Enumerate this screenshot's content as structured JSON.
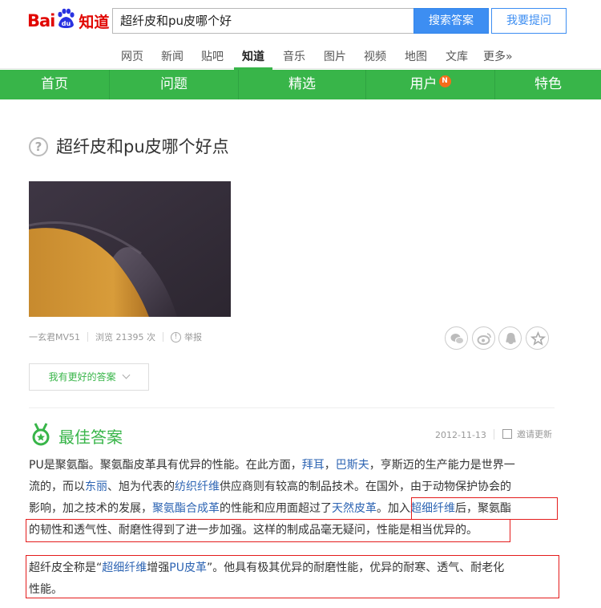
{
  "header": {
    "logo": {
      "bai": "Bai",
      "du": "du",
      "zhidao": "知道"
    },
    "search_value": "超纤皮和pu皮哪个好",
    "search_button": "搜索答案",
    "ask_button": "我要提问"
  },
  "channels": [
    "网页",
    "新闻",
    "贴吧",
    "知道",
    "音乐",
    "图片",
    "视频",
    "地图",
    "文库",
    "更多»"
  ],
  "active_channel": "知道",
  "green_nav": {
    "items": [
      "首页",
      "问题",
      "精选",
      "用户",
      "特色"
    ],
    "user_badge": "N"
  },
  "question": {
    "icon_glyph": "?",
    "title": "超纤皮和pu皮哪个好点",
    "author": "一玄君MV51",
    "views": "浏览 21395 次",
    "report_icon_glyph": "!",
    "report": "举报",
    "better_answer_button": "我有更好的答案",
    "share_icons": [
      "wechat-icon",
      "weibo-icon",
      "qq-icon",
      "favorite-star-icon"
    ]
  },
  "best_answer": {
    "title": "最佳答案",
    "date": "2012-11-13",
    "invite": "邀请更新",
    "lines": [
      [
        "PU是聚氨酯。聚氨酯皮革具有优异的性能。在此方面，",
        {
          "link": "拜耳"
        },
        "，",
        {
          "link": "巴斯夫"
        },
        "，亨斯迈的生产能力是世界一"
      ],
      [
        "流的，而以",
        {
          "link": "东丽"
        },
        "、旭为代表的",
        {
          "link": "纺织纤维"
        },
        "供应商则有较高的制品技术。在国外，由于动物保护协会的"
      ],
      [
        "影响，加之技术的发展，",
        {
          "link": "聚氨酯合成革"
        },
        "的性能和应用面超过了",
        {
          "link": "天然皮革"
        },
        "。加入",
        {
          "link": "超细纤维"
        },
        "后，聚氨酯"
      ],
      [
        "的韧性和透气性、耐磨性得到了进一步加强。这样的制成品毫无疑问，性能是相当优异的。"
      ],
      [
        "超纤皮全称是“",
        {
          "link": "超细纤维"
        },
        "增强",
        {
          "link": "PU皮革"
        },
        "”。他具有极其优异的耐磨性能，优异的耐寒、透气、耐老化"
      ],
      [
        "性能。"
      ]
    ]
  },
  "colors": {
    "brand_red": "#e10601",
    "baidu_blue": "#2932e1",
    "green": "#38b549",
    "link": "#2d64b3",
    "highlight_box": "#e41c1c"
  }
}
